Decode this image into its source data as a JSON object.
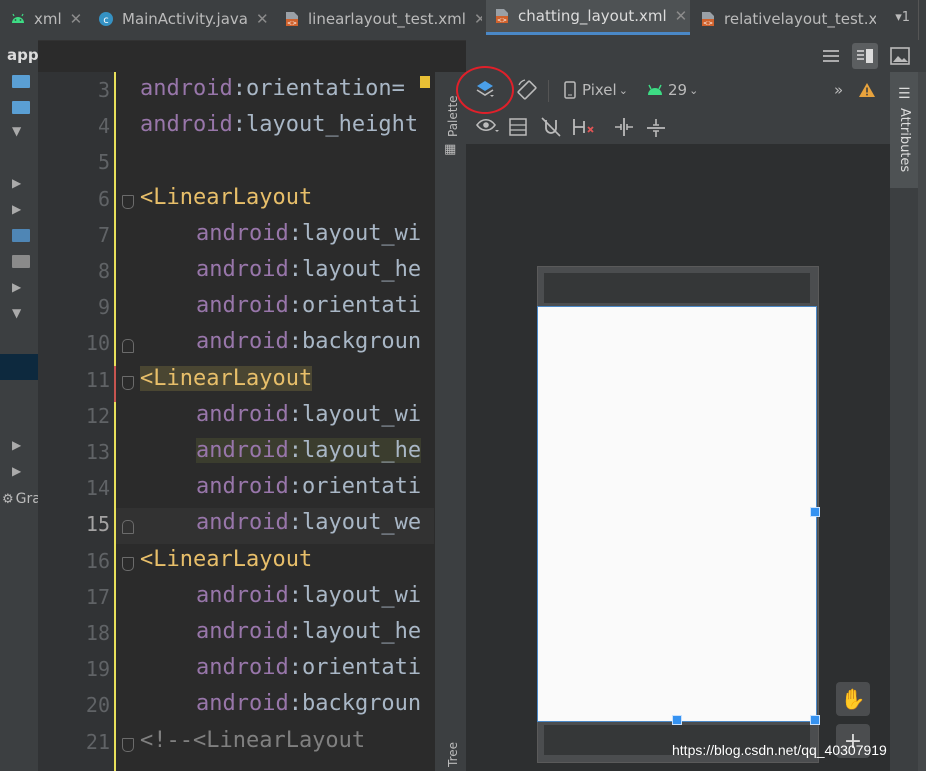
{
  "tabs": [
    {
      "label": "xml",
      "icon": "android-icon",
      "active": false
    },
    {
      "label": "MainActivity.java",
      "icon": "class-icon",
      "active": false
    },
    {
      "label": "linearlayout_test.xml",
      "icon": "xml-file-icon",
      "active": false
    },
    {
      "label": "chatting_layout.xml",
      "icon": "xml-file-icon",
      "active": true
    },
    {
      "label": "relativelayout_test.x",
      "icon": "xml-file-icon",
      "active": false
    }
  ],
  "tabs_more": "▾1",
  "project": {
    "header": "app",
    "footer": "Gra"
  },
  "editor": {
    "lines": [
      {
        "num": "3",
        "ns": "android",
        "rest": ":orientation=",
        "tag": ""
      },
      {
        "num": "4",
        "ns": "android",
        "rest": ":layout_height",
        "tag": ""
      },
      {
        "num": "5",
        "ns": "",
        "rest": "",
        "tag": ""
      },
      {
        "num": "6",
        "ns": "",
        "rest": "",
        "tag": "<LinearLayout"
      },
      {
        "num": "7",
        "ns": "android",
        "rest": ":layout_wi",
        "tag": ""
      },
      {
        "num": "8",
        "ns": "android",
        "rest": ":layout_he",
        "tag": ""
      },
      {
        "num": "9",
        "ns": "android",
        "rest": ":orientati",
        "tag": ""
      },
      {
        "num": "10",
        "ns": "android",
        "rest": ":backgroun",
        "tag": ""
      },
      {
        "num": "11",
        "ns": "",
        "rest": "",
        "tag": "<LinearLayout"
      },
      {
        "num": "12",
        "ns": "android",
        "rest": ":layout_wi",
        "tag": ""
      },
      {
        "num": "13",
        "ns": "android",
        "rest": ":layout_he",
        "tag": ""
      },
      {
        "num": "14",
        "ns": "android",
        "rest": ":orientati",
        "tag": ""
      },
      {
        "num": "15",
        "ns": "android",
        "rest": ":layout_we",
        "tag": ""
      },
      {
        "num": "16",
        "ns": "",
        "rest": "",
        "tag": "<LinearLayout"
      },
      {
        "num": "17",
        "ns": "android",
        "rest": ":layout_wi",
        "tag": ""
      },
      {
        "num": "18",
        "ns": "android",
        "rest": ":layout_he",
        "tag": ""
      },
      {
        "num": "19",
        "ns": "android",
        "rest": ":orientati",
        "tag": ""
      },
      {
        "num": "20",
        "ns": "android",
        "rest": ":backgroun",
        "tag": ""
      },
      {
        "num": "21",
        "ns": "",
        "rest": "",
        "tag": "<!--<LinearLayout"
      }
    ]
  },
  "side_panels": {
    "palette": "Palette",
    "tree": "Tree",
    "attributes": "Attributes"
  },
  "design_toolbar": {
    "device": "Pixel",
    "api": "29",
    "more": "»"
  },
  "watermark": "https://blog.csdn.net/qq_40307919",
  "colors": {
    "accent": "#4a88c7",
    "tag": "#e8bf6a",
    "attr_ns": "#9876aa",
    "annotation": "#e0202a"
  }
}
